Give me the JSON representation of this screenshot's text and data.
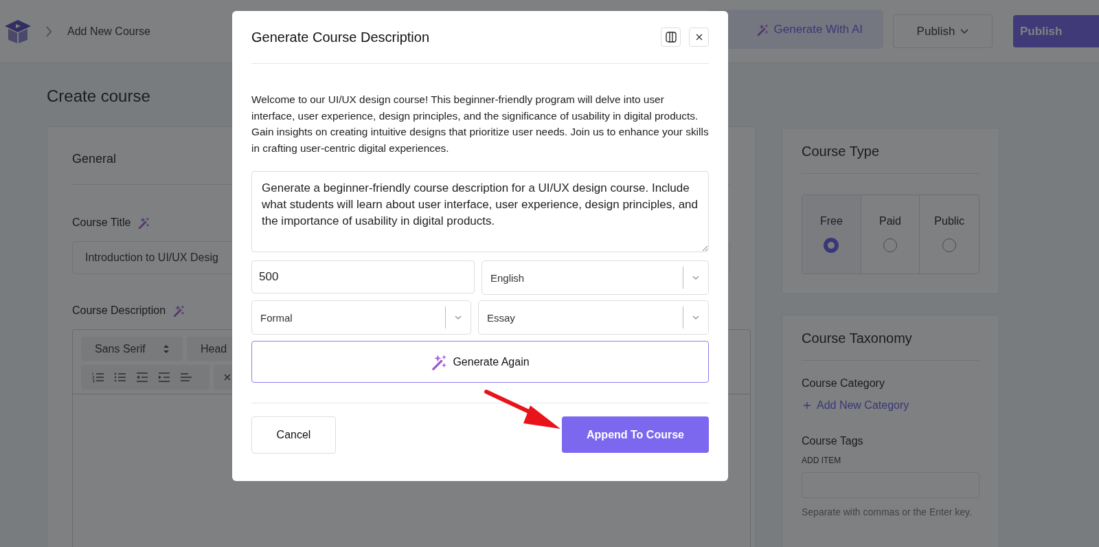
{
  "header": {
    "breadcrumb": "Add New Course",
    "generate_button": "Generate With AI",
    "publish_dropdown": "Publish",
    "publish_button": "Publish"
  },
  "page_title": "Create course",
  "general": {
    "title": "General",
    "course_title_label": "Course Title",
    "course_title_value": "Introduction to UI/UX Desig",
    "description_label": "Course Description",
    "font_select": "Sans Serif",
    "heading_select": "Head"
  },
  "course_type": {
    "title": "Course Type",
    "options": [
      {
        "label": "Free",
        "selected": true
      },
      {
        "label": "Paid",
        "selected": false
      },
      {
        "label": "Public",
        "selected": false
      }
    ]
  },
  "taxonomy": {
    "title": "Course Taxonomy",
    "category_label": "Course Category",
    "add_category_link": "Add New Category",
    "tags_label": "Course Tags",
    "add_item_label": "ADD ITEM",
    "tags_hint": "Separate with commas or the Enter key."
  },
  "modal": {
    "title": "Generate Course Description",
    "generated_text": "Welcome to our UI/UX design course! This beginner-friendly program will delve into user interface, user experience, design principles, and the significance of usability in digital products. Gain insights on creating intuitive designs that prioritize user needs. Join us to enhance your skills in crafting user-centric digital experiences.",
    "prompt": "Generate a beginner-friendly course description for a UI/UX design course. Include what students will learn about user interface, user experience, design principles, and the importance of usability in digital products.",
    "length": "500",
    "language": "English",
    "tone": "Formal",
    "format": "Essay",
    "generate_again": "Generate Again",
    "cancel": "Cancel",
    "append": "Append To Course"
  }
}
